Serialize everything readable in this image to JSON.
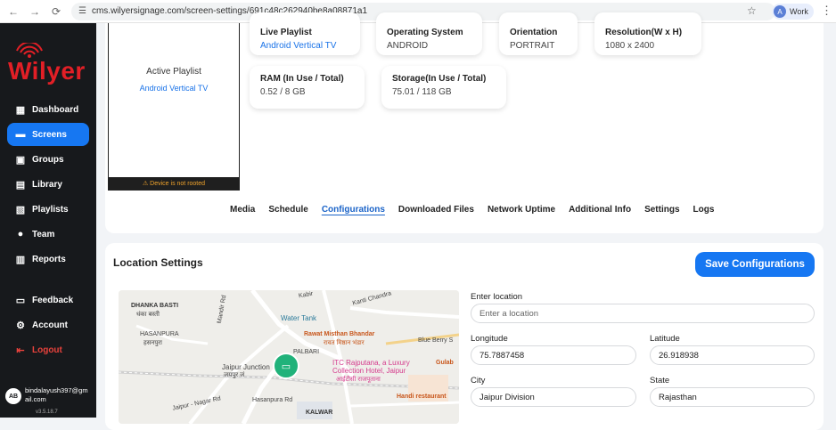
{
  "browser": {
    "url": "cms.wilyersignage.com/screen-settings/691c48c262940be8a08871a1",
    "profile_initial": "A",
    "profile_label": "Work"
  },
  "sidebar": {
    "brand": "Wilyer",
    "items": [
      {
        "label": "Dashboard",
        "icon": "dashboard-icon"
      },
      {
        "label": "Screens",
        "icon": "screen-icon"
      },
      {
        "label": "Groups",
        "icon": "groups-icon"
      },
      {
        "label": "Library",
        "icon": "library-icon"
      },
      {
        "label": "Playlists",
        "icon": "playlist-icon"
      },
      {
        "label": "Team",
        "icon": "team-icon"
      },
      {
        "label": "Reports",
        "icon": "reports-icon"
      }
    ],
    "bottom_items": [
      {
        "label": "Feedback",
        "icon": "feedback-icon"
      },
      {
        "label": "Account",
        "icon": "gear-icon"
      },
      {
        "label": "Logout",
        "icon": "logout-icon"
      }
    ],
    "user_initials": "AB",
    "user_email": "bindalayush397@gmail.com",
    "version": "v3.5.18.7"
  },
  "device": {
    "active_playlist_label": "Active Playlist",
    "active_playlist_value": "Android Vertical TV",
    "warning": "Device is not rooted"
  },
  "info": {
    "live_playlist": {
      "label": "Live Playlist",
      "value": "Android Vertical TV"
    },
    "os": {
      "label": "Operating System",
      "value": "ANDROID"
    },
    "orientation": {
      "label": "Orientation",
      "value": "PORTRAIT"
    },
    "resolution": {
      "label": "Resolution(W x H)",
      "value": "1080 x 2400"
    },
    "ram": {
      "label": "RAM (In Use / Total)",
      "value": "0.52 / 8 GB"
    },
    "storage": {
      "label": "Storage(In Use / Total)",
      "value": "75.01 / 118 GB"
    }
  },
  "tabs": [
    "Media",
    "Schedule",
    "Configurations",
    "Downloaded Files",
    "Network Uptime",
    "Additional Info",
    "Settings",
    "Logs"
  ],
  "location": {
    "title": "Location Settings",
    "save_label": "Save Configurations",
    "enter_location_label": "Enter location",
    "enter_location_placeholder": "Enter a location",
    "longitude_label": "Longitude",
    "longitude_value": "75.7887458",
    "latitude_label": "Latitude",
    "latitude_value": "26.918938",
    "city_label": "City",
    "city_value": "Jaipur Division",
    "state_label": "State",
    "state_value": "Rajasthan"
  },
  "map": {
    "labels": {
      "dhanka_basti": "DHANKA BASTI",
      "dhanka_basti_hi": "धंका बस्ती",
      "hasanpura": "HASANPURA",
      "hasanpura_hi": "हसनपुरा",
      "water_tank": "Water Tank",
      "rawat": "Rawat Misthan Bhandar",
      "rawat_hi": "रावत मिष्ठान भंडार",
      "blue_berry": "Blue Berry S",
      "palbari": "PALBARI",
      "jaipur_junction": "Jaipur Junction",
      "jaipur_junction_hi": "जयपुर जं",
      "itc": "ITC Rajputana, a Luxury",
      "itc2": "Collection Hotel, Jaipur",
      "itc_hi": "आईटीसी राजपूताना",
      "gulab": "Gulab",
      "jaipur_nagar": "Jaipur - Nagar Rd",
      "hasanpura_rd": "Hasanpura Rd",
      "handi": "Handi restaurant",
      "kalwar": "KALWAR",
      "kabir": "Kabir",
      "kanti_chandra": "Kanti Chandra",
      "mandir_rd": "Mandir Rd"
    }
  },
  "colors": {
    "accent": "#1677f2",
    "sidebar_bg": "#17191c",
    "brand_red": "#e21f26",
    "pin_green": "#20b27a"
  }
}
